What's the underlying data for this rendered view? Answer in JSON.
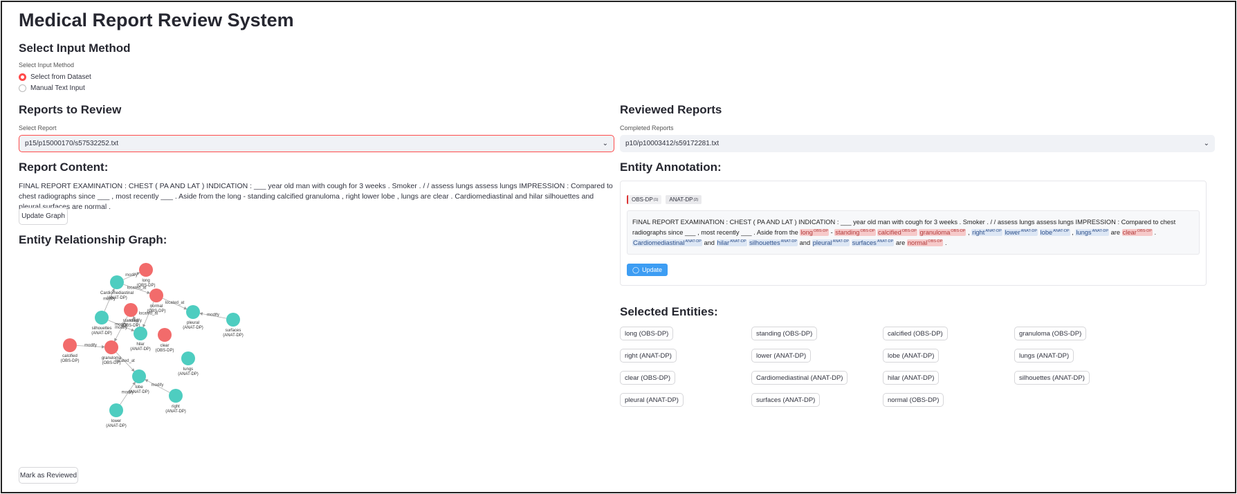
{
  "app": {
    "title": "Medical Report Review System"
  },
  "input_method": {
    "heading": "Select Input Method",
    "label": "Select Input Method",
    "options": [
      {
        "label": "Select from Dataset",
        "selected": true
      },
      {
        "label": "Manual Text Input",
        "selected": false
      }
    ]
  },
  "reports_to_review": {
    "heading": "Reports to Review",
    "select_label": "Select Report",
    "selected_value": "p15/p15000170/s57532252.txt"
  },
  "reviewed_reports": {
    "heading": "Reviewed Reports",
    "select_label": "Completed Reports",
    "selected_value": "p10/p10003412/s59172281.txt"
  },
  "report_content": {
    "heading": "Report Content:",
    "text": "FINAL REPORT EXAMINATION : CHEST ( PA AND LAT ) INDICATION : ___ year old man with cough for 3 weeks . Smoker . / / assess lungs assess lungs IMPRESSION : Compared to chest radiographs since ___ , most recently ___ . Aside from the long - standing calcified granuloma , right lower lobe , lungs are clear . Cardiomediastinal and hilar silhouettes and pleural surfaces are normal .",
    "update_button": "Update Graph"
  },
  "graph": {
    "heading": "Entity Relationship Graph:",
    "colors": {
      "obs": "#f26b6b",
      "anat": "#4ecdc0"
    },
    "nodes": [
      {
        "id": "long",
        "label": "long",
        "type": "(OBS-DP)",
        "kind": "obs"
      },
      {
        "id": "cardio",
        "label": "Cardiomediastinal",
        "type": "(ANAT-DP)",
        "kind": "anat"
      },
      {
        "id": "normal",
        "label": "normal",
        "type": "(OBS-DP)",
        "kind": "obs"
      },
      {
        "id": "standing",
        "label": "standing",
        "type": "(OBS-DP)",
        "kind": "obs"
      },
      {
        "id": "silhouettes",
        "label": "silhouettes",
        "type": "(ANAT-DP)",
        "kind": "anat"
      },
      {
        "id": "pleural",
        "label": "pleural",
        "type": "(ANAT-DP)",
        "kind": "anat"
      },
      {
        "id": "surfaces",
        "label": "surfaces",
        "type": "(ANAT-DP)",
        "kind": "anat"
      },
      {
        "id": "hilar",
        "label": "hilar",
        "type": "(ANAT-DP)",
        "kind": "anat"
      },
      {
        "id": "clear",
        "label": "clear",
        "type": "(OBS-DP)",
        "kind": "obs"
      },
      {
        "id": "calcified",
        "label": "calcified",
        "type": "(OBS-DP)",
        "kind": "obs"
      },
      {
        "id": "granuloma",
        "label": "granuloma",
        "type": "(OBS-DP)",
        "kind": "obs"
      },
      {
        "id": "lungs",
        "label": "lungs",
        "type": "(ANAT-DP)",
        "kind": "anat"
      },
      {
        "id": "lobe",
        "label": "lobe",
        "type": "(ANAT-DP)",
        "kind": "anat"
      },
      {
        "id": "right",
        "label": "right",
        "type": "(ANAT-DP)",
        "kind": "anat"
      },
      {
        "id": "lower",
        "label": "lower",
        "type": "(ANAT-DP)",
        "kind": "anat"
      }
    ],
    "edges": [
      {
        "from": "cardio",
        "to": "long",
        "label": "modify"
      },
      {
        "from": "cardio",
        "to": "normal",
        "label": "located_at"
      },
      {
        "from": "silhouettes",
        "to": "cardio",
        "label": "modify"
      },
      {
        "from": "normal",
        "to": "pleural",
        "label": "located_at"
      },
      {
        "from": "surfaces",
        "to": "pleural",
        "label": "modify"
      },
      {
        "from": "normal",
        "to": "hilar",
        "label": "located_at"
      },
      {
        "from": "silhouettes",
        "to": "hilar",
        "label": "modify"
      },
      {
        "from": "standing",
        "to": "granuloma",
        "label": "modify"
      },
      {
        "from": "calcified",
        "to": "granuloma",
        "label": "modify"
      },
      {
        "from": "granuloma",
        "to": "lobe",
        "label": "located_at"
      },
      {
        "from": "right",
        "to": "lobe",
        "label": "modify"
      },
      {
        "from": "lower",
        "to": "lobe",
        "label": "modify"
      },
      {
        "from": "hilar",
        "to": "standing",
        "label": "modify"
      }
    ],
    "mark_button": "Mark as Reviewed"
  },
  "annotation": {
    "heading": "Entity Annotation:",
    "legend": [
      {
        "label": "OBS-DP",
        "count": "(1)"
      },
      {
        "label": "ANAT-DP",
        "count": "(2)"
      }
    ],
    "segments": [
      {
        "t": "FINAL REPORT EXAMINATION : CHEST ( PA AND LAT ) INDICATION : ___ year old man with cough for 3 weeks . Smoker . / / assess lungs assess lungs IMPRESSION : Compared to chest radiographs since ___ , most recently ___ . Aside from the ",
        "k": ""
      },
      {
        "t": "long",
        "k": "obs"
      },
      {
        "t": " - ",
        "k": ""
      },
      {
        "t": "standing",
        "k": "obs"
      },
      {
        "t": " ",
        "k": ""
      },
      {
        "t": "calcified",
        "k": "obs"
      },
      {
        "t": " ",
        "k": ""
      },
      {
        "t": "granuloma",
        "k": "obs"
      },
      {
        "t": " , ",
        "k": ""
      },
      {
        "t": "right",
        "k": "anat"
      },
      {
        "t": " ",
        "k": ""
      },
      {
        "t": "lower",
        "k": "anat"
      },
      {
        "t": " ",
        "k": ""
      },
      {
        "t": "lobe",
        "k": "anat"
      },
      {
        "t": " , ",
        "k": ""
      },
      {
        "t": "lungs",
        "k": "anat"
      },
      {
        "t": " are ",
        "k": ""
      },
      {
        "t": "clear",
        "k": "obs"
      },
      {
        "t": " . ",
        "k": ""
      },
      {
        "t": "Cardiomediastinal",
        "k": "anat"
      },
      {
        "t": " and ",
        "k": ""
      },
      {
        "t": "hilar",
        "k": "anat"
      },
      {
        "t": " ",
        "k": ""
      },
      {
        "t": "silhouettes",
        "k": "anat"
      },
      {
        "t": " and ",
        "k": ""
      },
      {
        "t": "pleural",
        "k": "anat"
      },
      {
        "t": " ",
        "k": ""
      },
      {
        "t": "surfaces",
        "k": "anat"
      },
      {
        "t": " are ",
        "k": ""
      },
      {
        "t": "normal",
        "k": "obs"
      },
      {
        "t": " .",
        "k": ""
      }
    ],
    "tag_obs": "OBS-DP",
    "tag_anat": "ANAT-DP",
    "update_button": "Update",
    "update_icon": "check-circle-icon"
  },
  "selected_entities": {
    "heading": "Selected Entities:",
    "items": [
      "long (OBS-DP)",
      "standing (OBS-DP)",
      "calcified (OBS-DP)",
      "granuloma (OBS-DP)",
      "right (ANAT-DP)",
      "lower (ANAT-DP)",
      "lobe (ANAT-DP)",
      "lungs (ANAT-DP)",
      "clear (OBS-DP)",
      "Cardiomediastinal (ANAT-DP)",
      "hilar (ANAT-DP)",
      "silhouettes (ANAT-DP)",
      "pleural (ANAT-DP)",
      "surfaces (ANAT-DP)",
      "normal (OBS-DP)"
    ]
  },
  "colors": {
    "accent": "#ff4b4b",
    "button_blue": "#3d9df3"
  }
}
